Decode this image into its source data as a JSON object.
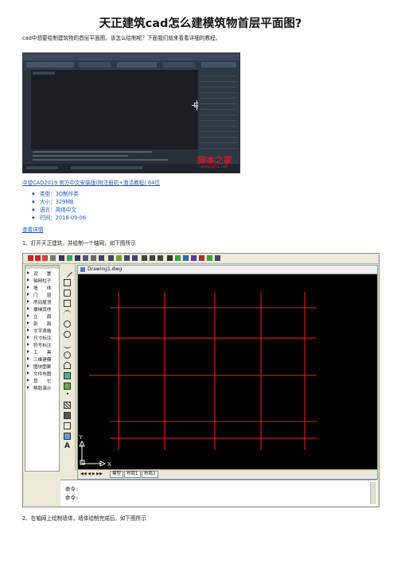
{
  "article": {
    "title": "天正建筑cad怎么建模筑物首层平面图?",
    "intro": "cad中想要绘制建筑物的首层平面图，该怎么绘制呢？下面我们就来看看详细的教程。",
    "download": {
      "link_text": "中望CAD2019 官方中文安装版(附注册机+激活教程) 64位",
      "items": [
        {
          "label": "类型：",
          "value": "3D制作类"
        },
        {
          "label": "大小：",
          "value": "329MB"
        },
        {
          "label": "语言：",
          "value": "简体中文"
        },
        {
          "label": "时间：",
          "value": "2018-09-06"
        }
      ],
      "details_link": "查看详情"
    },
    "step1": "1、打开天正建筑，并绘制一个轴网，如下图所示",
    "step2": "2、在轴网上绘制墙体，墙体绘制完成后，如下图所示"
  },
  "screenshot1": {
    "watermark": "脚本之家",
    "watermark_url": "www.jb51.net"
  },
  "screenshot2": {
    "side_menu": [
      "设　　置",
      "轴网柱子",
      "墙　　体",
      "门　　窗",
      "房间屋顶",
      "楼梯其他",
      "立　　面",
      "剖　　面",
      "文字表格",
      "尺寸标注",
      "符号标注",
      "工　　具",
      "三维建模",
      "图块图案",
      "文件布图",
      "其　　它",
      "帮助演示"
    ],
    "drawing_title": "Drawing1.dwg",
    "layout_tabs": [
      "模型",
      "布局1",
      "布局2"
    ],
    "command_lines": [
      "命令:",
      "命令:"
    ],
    "ucs_x": "X",
    "ucs_y": "Y"
  },
  "colors": {
    "link": "#1a56c4",
    "axis_line": "#ff1a1a",
    "canvas": "#000000"
  }
}
